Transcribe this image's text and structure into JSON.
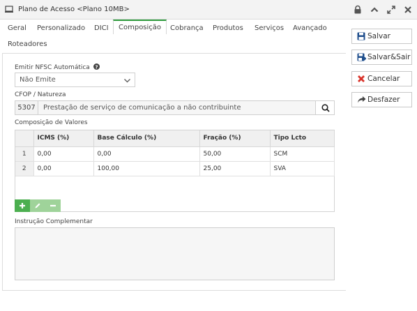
{
  "window": {
    "title": "Plano de Acesso <Plano 10MB>"
  },
  "tabs": [
    {
      "label": "Geral"
    },
    {
      "label": "Personalizado"
    },
    {
      "label": "DICI"
    },
    {
      "label": "Composição",
      "active": true
    },
    {
      "label": "Cobrança"
    },
    {
      "label": "Produtos"
    },
    {
      "label": "Serviços"
    },
    {
      "label": "Avançado"
    },
    {
      "label": "Roteadores"
    }
  ],
  "form": {
    "nfsc_label": "Emitir NFSC Automática",
    "nfsc_value": "Não Emite",
    "cfop_label": "CFOP / Natureza",
    "cfop_code": "5307",
    "cfop_description": "Prestação de serviço de comunicação a não contribuinte",
    "composition_label": "Composição de Valores",
    "instruction_label": "Instrução Complementar",
    "instruction_value": ""
  },
  "grid": {
    "columns": [
      "ICMS (%)",
      "Base Cálculo (%)",
      "Fração (%)",
      "Tipo Lcto"
    ],
    "rows": [
      {
        "num": "1",
        "icms": "0,00",
        "base": "0,00",
        "fracao": "50,00",
        "tipo": "SCM"
      },
      {
        "num": "2",
        "icms": "0,00",
        "base": "100,00",
        "fracao": "25,00",
        "tipo": "SVA"
      }
    ]
  },
  "actions": {
    "save": "Salvar",
    "save_exit": "Salvar&Sair",
    "cancel": "Cancelar",
    "undo": "Desfazer"
  },
  "colors": {
    "accent_green": "#2e9b3d",
    "grid_button_green": "#4caf50",
    "grid_button_disabled": "#9fd39a",
    "save_icon_blue": "#1f4e8c",
    "cancel_icon_red": "#d9342b"
  },
  "icons": {
    "window": "monitor-icon",
    "lock": "lock-icon",
    "collapse": "chevron-up-icon",
    "maximize": "maximize-icon",
    "close": "close-icon",
    "help": "help-icon",
    "search": "search-icon",
    "add": "plus-icon",
    "edit": "pencil-icon",
    "remove": "minus-icon",
    "save": "floppy-icon",
    "save_exit": "floppy-exit-icon",
    "cancel": "x-icon",
    "undo": "share-arrow-icon"
  }
}
